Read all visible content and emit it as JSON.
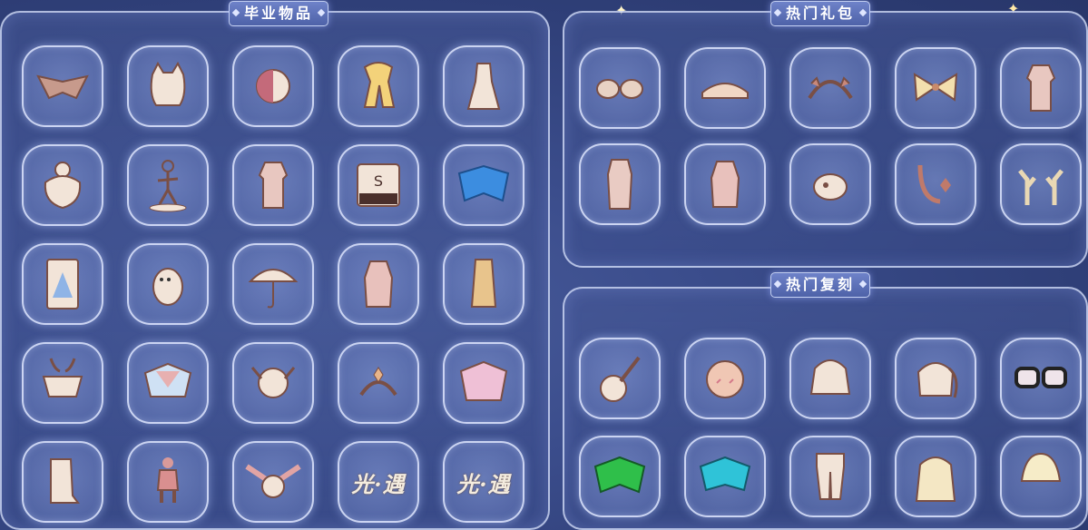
{
  "panels": {
    "graduation": {
      "title": "毕业物品",
      "items": [
        {
          "name": "cape-wings-icon"
        },
        {
          "name": "hair-ears-icon"
        },
        {
          "name": "mask-icon"
        },
        {
          "name": "scarf-icon"
        },
        {
          "name": "dress-icon"
        },
        {
          "name": "hair-bun-icon"
        },
        {
          "name": "pose-figure-icon"
        },
        {
          "name": "outfit-icon"
        },
        {
          "name": "piano-icon"
        },
        {
          "name": "blue-cape-icon"
        },
        {
          "name": "card-icon"
        },
        {
          "name": "moomin-icon"
        },
        {
          "name": "umbrella-icon"
        },
        {
          "name": "coat-icon"
        },
        {
          "name": "robe-icon"
        },
        {
          "name": "deer-mask-icon"
        },
        {
          "name": "collar-cape-icon"
        },
        {
          "name": "crab-mask-icon"
        },
        {
          "name": "crown-headband-icon"
        },
        {
          "name": "pink-cape-icon"
        },
        {
          "name": "boots-icon"
        },
        {
          "name": "small-outfit-icon"
        },
        {
          "name": "winged-mask-icon"
        },
        {
          "name": "logo-icon",
          "text": "光·遇"
        },
        {
          "name": "logo-icon",
          "text": "光·遇"
        }
      ]
    },
    "hot_gifts": {
      "title": "热门礼包",
      "items": [
        {
          "name": "sunglasses-icon"
        },
        {
          "name": "hat-icon"
        },
        {
          "name": "headband-icon"
        },
        {
          "name": "bow-icon"
        },
        {
          "name": "outfit-icon"
        },
        {
          "name": "long-outfit-icon"
        },
        {
          "name": "coat-icon"
        },
        {
          "name": "spirit-icon"
        },
        {
          "name": "tail-icon"
        },
        {
          "name": "antlers-icon"
        }
      ]
    },
    "hot_reruns": {
      "title": "热门复刻",
      "items": [
        {
          "name": "guitar-icon"
        },
        {
          "name": "face-mask-icon"
        },
        {
          "name": "pigtails-hair-icon"
        },
        {
          "name": "ponytail-hair-icon"
        },
        {
          "name": "glasses-icon"
        },
        {
          "name": "green-cape-icon"
        },
        {
          "name": "cyan-cape-icon"
        },
        {
          "name": "pants-icon"
        },
        {
          "name": "long-hair-icon"
        },
        {
          "name": "short-hair-icon"
        }
      ]
    }
  }
}
